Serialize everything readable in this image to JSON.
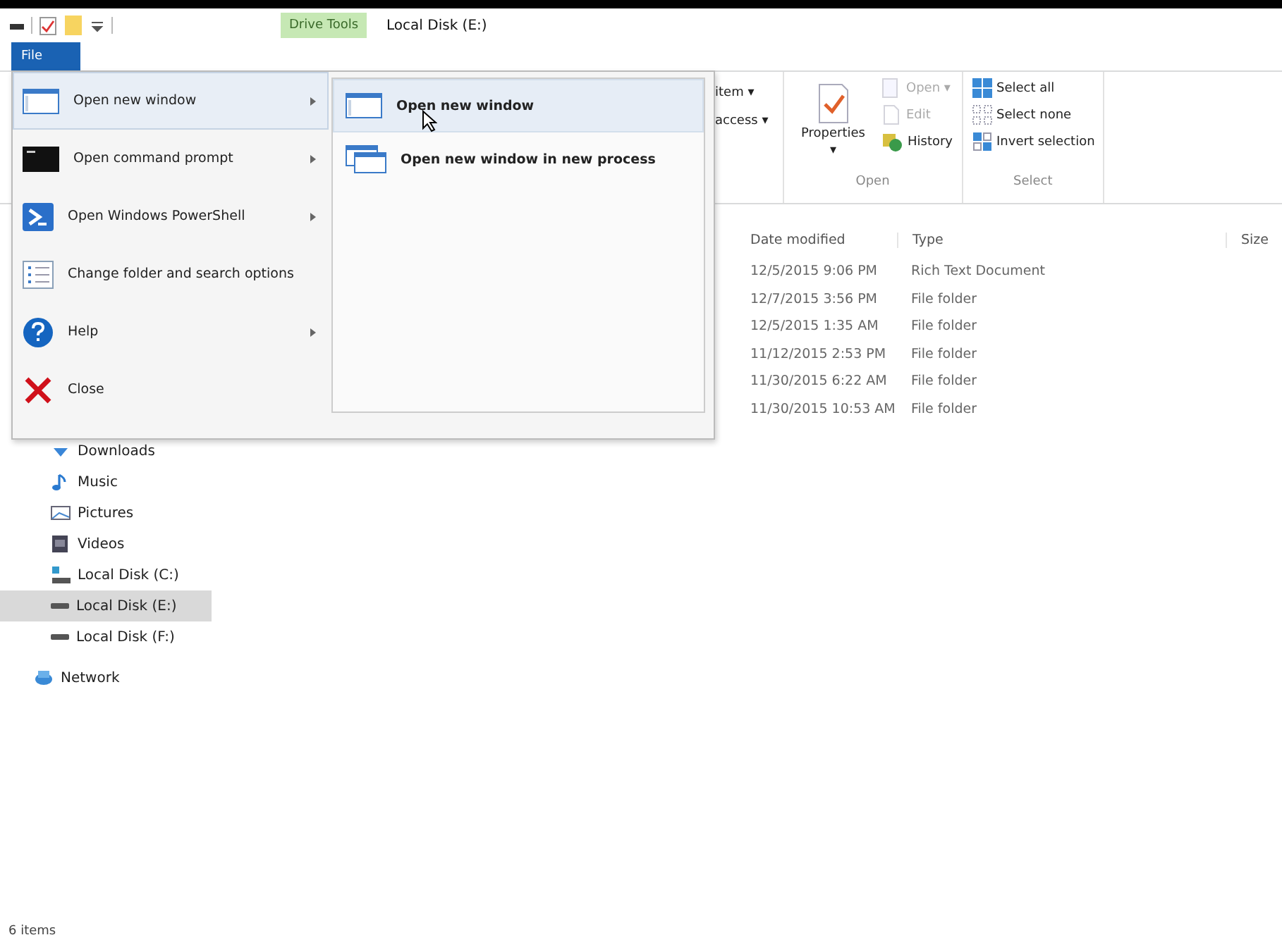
{
  "title_bar": {
    "context_tab": "Drive Tools",
    "title": "Local Disk (E:)"
  },
  "file_tab": {
    "label": "File",
    "selected": true
  },
  "ribbon": {
    "partial_commands": [
      "item ▾",
      "access ▾"
    ],
    "groups": [
      {
        "label": "Open",
        "large": {
          "label": "Properties",
          "caret": "▾"
        },
        "commands": [
          {
            "label": "Open ▾",
            "kind": "open",
            "disabled": true
          },
          {
            "label": "Edit",
            "kind": "edit",
            "disabled": true
          },
          {
            "label": "History",
            "kind": "history",
            "disabled": false
          }
        ]
      },
      {
        "label": "Select",
        "commands": [
          {
            "label": "Select all",
            "kind": "select-all",
            "disabled": false
          },
          {
            "label": "Select none",
            "kind": "select-none",
            "disabled": false
          },
          {
            "label": "Invert selection",
            "kind": "invert",
            "disabled": false
          }
        ]
      }
    ]
  },
  "file_list": {
    "columns": [
      "Date modified",
      "Type",
      "Size"
    ],
    "rows": [
      {
        "date_modified": "12/5/2015 9:06 PM",
        "type": "Rich Text Document"
      },
      {
        "date_modified": "12/7/2015 3:56 PM",
        "type": "File folder"
      },
      {
        "date_modified": "12/5/2015 1:35 AM",
        "type": "File folder"
      },
      {
        "date_modified": "11/12/2015 2:53 PM",
        "type": "File folder"
      },
      {
        "date_modified": "11/30/2015 6:22 AM",
        "type": "File folder"
      },
      {
        "date_modified": "11/30/2015 10:53 AM",
        "type": "File folder"
      }
    ]
  },
  "navigation": {
    "items": [
      {
        "label": "Downloads",
        "kind": "downloads",
        "selected": false
      },
      {
        "label": "Music",
        "kind": "music",
        "selected": false
      },
      {
        "label": "Pictures",
        "kind": "pictures",
        "selected": false
      },
      {
        "label": "Videos",
        "kind": "videos",
        "selected": false
      },
      {
        "label": "Local Disk (C:)",
        "kind": "system-disk",
        "selected": false
      },
      {
        "label": "Local Disk (E:)",
        "kind": "disk",
        "selected": true
      },
      {
        "label": "Local Disk (F:)",
        "kind": "disk",
        "selected": false
      },
      {
        "label": "Network",
        "kind": "network",
        "selected": false
      }
    ]
  },
  "file_menu": {
    "items": [
      {
        "label": "Open new window",
        "kind": "window",
        "has_submenu": true,
        "selected": true
      },
      {
        "label": "Open command prompt",
        "kind": "prompt",
        "has_submenu": true,
        "selected": false
      },
      {
        "label": "Open Windows PowerShell",
        "kind": "powershell",
        "has_submenu": true,
        "selected": false
      },
      {
        "label": "Change folder and search options",
        "kind": "options",
        "has_submenu": false,
        "selected": false
      },
      {
        "label": "Help",
        "kind": "help",
        "has_submenu": true,
        "selected": false
      },
      {
        "label": "Close",
        "kind": "close",
        "has_submenu": false,
        "selected": false
      }
    ],
    "submenu": [
      {
        "label": "Open new window",
        "kind": "window",
        "selected": true
      },
      {
        "label": "Open new window in new process",
        "kind": "windows",
        "selected": false
      }
    ]
  },
  "status_bar": {
    "text": "6 items"
  }
}
